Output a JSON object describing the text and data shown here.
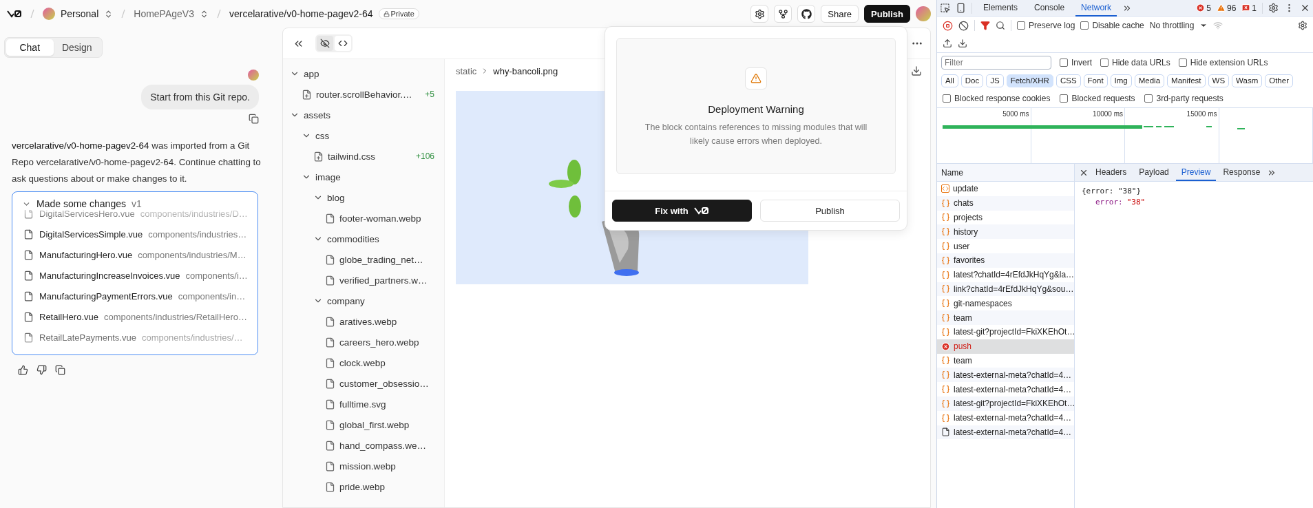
{
  "topbar": {
    "workspace": "Personal",
    "project": "HomePAgeV3",
    "repo": "vercelarative/v0-home-pagev2-64",
    "visibility": "Private",
    "share": "Share",
    "publish": "Publish"
  },
  "mode_tabs": [
    {
      "label": "Chat",
      "selected": true
    },
    {
      "label": "Design",
      "selected": false
    }
  ],
  "chat": {
    "user_message": "Start from this Git repo.",
    "reply": "**vercelarative/v0-home-pagev2-64** was imported from a Git Repo vercelarative/v0-home-pagev2-64. Continue chatting to ask questions about or make changes to it.",
    "changes": {
      "title": "Made some changes",
      "version": "v1",
      "expanded": true,
      "files": [
        {
          "name": "DigitalServicesHero.vue",
          "path": "components/industries/D…"
        },
        {
          "name": "DigitalServicesSimple.vue",
          "path": "components/industries…"
        },
        {
          "name": "ManufacturingHero.vue",
          "path": "components/industries/M…"
        },
        {
          "name": "ManufacturingIncreaseInvoices.vue",
          "path": "components/i…"
        },
        {
          "name": "ManufacturingPaymentErrors.vue",
          "path": "components/in…"
        },
        {
          "name": "RetailHero.vue",
          "path": "components/industries/RetailHero…"
        },
        {
          "name": "RetailLatePayments.vue",
          "path": "components/industries/…"
        }
      ]
    }
  },
  "file_tree": [
    {
      "name": "app",
      "kind": "folder",
      "expanded": true,
      "children": [
        {
          "name": "router.scrollBehavior.…",
          "kind": "new-file",
          "added": "+5"
        }
      ]
    },
    {
      "name": "assets",
      "kind": "folder",
      "expanded": true,
      "children": [
        {
          "name": "css",
          "kind": "folder",
          "expanded": true,
          "children": [
            {
              "name": "tailwind.css",
              "kind": "new-file",
              "added": "+106"
            }
          ]
        },
        {
          "name": "image",
          "kind": "folder",
          "expanded": true,
          "children": [
            {
              "name": "blog",
              "kind": "folder",
              "expanded": true,
              "children": [
                {
                  "name": "footer-woman.webp",
                  "kind": "file"
                }
              ]
            },
            {
              "name": "commodities",
              "kind": "folder",
              "expanded": true,
              "children": [
                {
                  "name": "globe_trading_net…",
                  "kind": "file"
                },
                {
                  "name": "verified_partners.w…",
                  "kind": "file"
                }
              ]
            },
            {
              "name": "company",
              "kind": "folder",
              "expanded": true,
              "children": [
                {
                  "name": "aratives.webp",
                  "kind": "file"
                },
                {
                  "name": "careers_hero.webp",
                  "kind": "file"
                },
                {
                  "name": "clock.webp",
                  "kind": "file"
                },
                {
                  "name": "customer_obsessio…",
                  "kind": "file"
                },
                {
                  "name": "fulltime.svg",
                  "kind": "file"
                },
                {
                  "name": "global_first.webp",
                  "kind": "file"
                },
                {
                  "name": "hand_compass.we…",
                  "kind": "file"
                },
                {
                  "name": "mission.webp",
                  "kind": "file"
                },
                {
                  "name": "pride.webp",
                  "kind": "file"
                }
              ]
            }
          ]
        }
      ]
    }
  ],
  "preview": {
    "breadcrumb": [
      "static",
      "why-bancoli.png"
    ],
    "image": {
      "kind": "picture"
    }
  },
  "dialog": {
    "title": "Deployment Warning",
    "message": "The block contains references to missing modules that will likely cause errors when deployed.",
    "fix_label": "Fix with",
    "publish_label": "Publish"
  },
  "devtools": {
    "tabs": [
      {
        "label": "Elements",
        "selected": false
      },
      {
        "label": "Console",
        "selected": false
      },
      {
        "label": "Network",
        "selected": true
      }
    ],
    "errors": "5",
    "warnings": "96",
    "issues": "1",
    "toolbar_checks": [
      {
        "label": "Preserve log",
        "checked": false
      },
      {
        "label": "Disable cache",
        "checked": false
      }
    ],
    "throttling": "No throttling",
    "filter_placeholder": "Filter",
    "filter_checks": [
      {
        "label": "Invert",
        "checked": false
      },
      {
        "label": "Hide data URLs",
        "checked": false
      },
      {
        "label": "Hide extension URLs",
        "checked": false
      }
    ],
    "type_filters": [
      {
        "label": "All",
        "selected": false
      },
      {
        "label": "Doc",
        "selected": false
      },
      {
        "label": "JS",
        "selected": false
      },
      {
        "label": "Fetch/XHR",
        "selected": true
      },
      {
        "label": "CSS",
        "selected": false
      },
      {
        "label": "Font",
        "selected": false
      },
      {
        "label": "Img",
        "selected": false
      },
      {
        "label": "Media",
        "selected": false
      },
      {
        "label": "Manifest",
        "selected": false
      },
      {
        "label": "WS",
        "selected": false
      },
      {
        "label": "Wasm",
        "selected": false
      },
      {
        "label": "Other",
        "selected": false
      }
    ],
    "blocked_checks": [
      {
        "label": "Blocked response cookies",
        "checked": false
      },
      {
        "label": "Blocked requests",
        "checked": false
      },
      {
        "label": "3rd-party requests",
        "checked": false
      }
    ],
    "timeline_ticks": [
      "5000 ms",
      "10000 ms",
      "15000 ms"
    ],
    "requests": {
      "column": "Name",
      "rows": [
        {
          "name": "update",
          "kind": "socket",
          "selected": false
        },
        {
          "name": "chats",
          "kind": "fetch",
          "selected": false
        },
        {
          "name": "projects",
          "kind": "fetch",
          "selected": false
        },
        {
          "name": "history",
          "kind": "fetch",
          "selected": false
        },
        {
          "name": "user",
          "kind": "fetch",
          "selected": false
        },
        {
          "name": "favorites",
          "kind": "fetch",
          "selected": false
        },
        {
          "name": "latest?chatId=4rEfdJkHqYg&la…",
          "kind": "fetch",
          "selected": false
        },
        {
          "name": "link?chatId=4rEfdJkHqYg&sou…",
          "kind": "fetch",
          "selected": false
        },
        {
          "name": "git-namespaces",
          "kind": "fetch",
          "selected": false
        },
        {
          "name": "team",
          "kind": "fetch",
          "selected": false
        },
        {
          "name": "latest-git?projectId=FkiXKEhOt…",
          "kind": "fetch",
          "selected": false
        },
        {
          "name": "push",
          "kind": "error",
          "selected": true
        },
        {
          "name": "team",
          "kind": "fetch",
          "selected": false
        },
        {
          "name": "latest-external-meta?chatId=4…",
          "kind": "fetch",
          "selected": false
        },
        {
          "name": "latest-external-meta?chatId=4…",
          "kind": "fetch",
          "selected": false
        },
        {
          "name": "latest-git?projectId=FkiXKEhOt…",
          "kind": "fetch",
          "selected": false
        },
        {
          "name": "latest-external-meta?chatId=4…",
          "kind": "fetch",
          "selected": false
        },
        {
          "name": "latest-external-meta?chatId=4…",
          "kind": "document",
          "selected": false
        }
      ]
    },
    "detail_tabs": [
      {
        "label": "Headers",
        "selected": false
      },
      {
        "label": "Payload",
        "selected": false
      },
      {
        "label": "Preview",
        "selected": true
      },
      {
        "label": "Response",
        "selected": false
      }
    ],
    "response_preview": {
      "summary": "{error: \"38\"}",
      "key": "error:",
      "value": "\"38\""
    }
  }
}
